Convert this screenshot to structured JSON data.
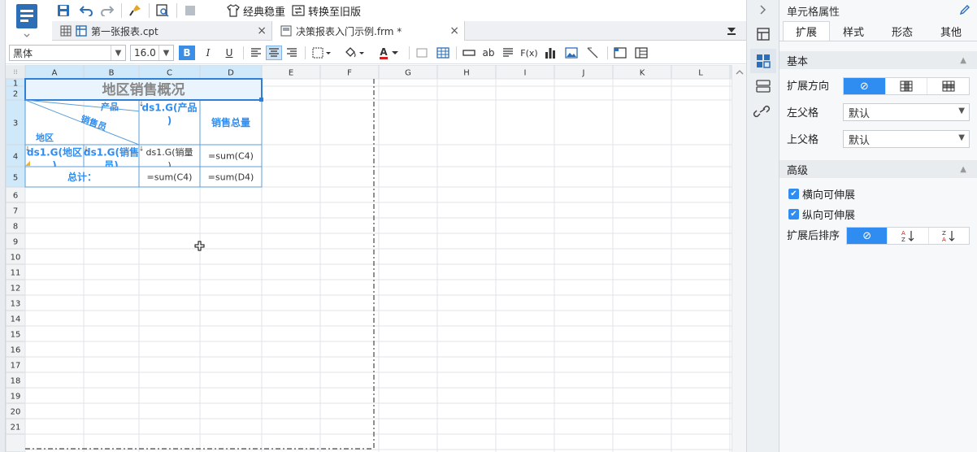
{
  "toolbar": {
    "classic_label": "经典稳重",
    "convert_label": "转换至旧版"
  },
  "tabs": [
    {
      "label": "第一张报表.cpt",
      "close": "×"
    },
    {
      "label": "决策报表入门示例.frm *",
      "close": "×"
    }
  ],
  "format": {
    "font_name": "黑体",
    "font_size": "16.0",
    "bold": "B",
    "italic": "I",
    "underline": "U",
    "font_color_glyph": "A",
    "text_ab": "ab",
    "fx": "F(x)"
  },
  "grid": {
    "columns": [
      "A",
      "B",
      "C",
      "D",
      "E",
      "F",
      "G",
      "H",
      "I",
      "J",
      "K",
      "L"
    ],
    "rows": [
      "1",
      "2",
      "3",
      "4",
      "5",
      "6",
      "7",
      "8",
      "9",
      "10",
      "11",
      "12",
      "13",
      "14",
      "15",
      "16",
      "17",
      "18",
      "19",
      "20",
      "21"
    ],
    "cells": {
      "title": "地区销售概况",
      "slash_product": "产品",
      "slash_salesman": "销售员",
      "slash_region": "地区",
      "c3": "ds1.G(产品)",
      "d3": "销售总量",
      "a4": "ds1.G(地区)",
      "b4": "ds1.G(销售员)",
      "c4": "ds1.G(销量)",
      "d4": "=sum(C4)",
      "ab5": "总计：",
      "c5": "=sum(C4)",
      "d5": "=sum(D4)"
    }
  },
  "panel": {
    "title": "单元格属性",
    "tabs": [
      "扩展",
      "样式",
      "形态",
      "其他"
    ],
    "basic_header": "基本",
    "expand_direction_label": "扩展方向",
    "left_parent_label": "左父格",
    "left_parent_value": "默认",
    "top_parent_label": "上父格",
    "top_parent_value": "默认",
    "advanced_header": "高级",
    "horizontal_expand_label": "横向可伸展",
    "vertical_expand_label": "纵向可伸展",
    "sort_after_expand_label": "扩展后排序",
    "none_glyph": "⊘"
  },
  "colors": {
    "accent": "#2f8cf0",
    "header_selected": "#cfe8fa",
    "cell_text_blue": "#2f8cf0",
    "title_text": "#888888"
  }
}
